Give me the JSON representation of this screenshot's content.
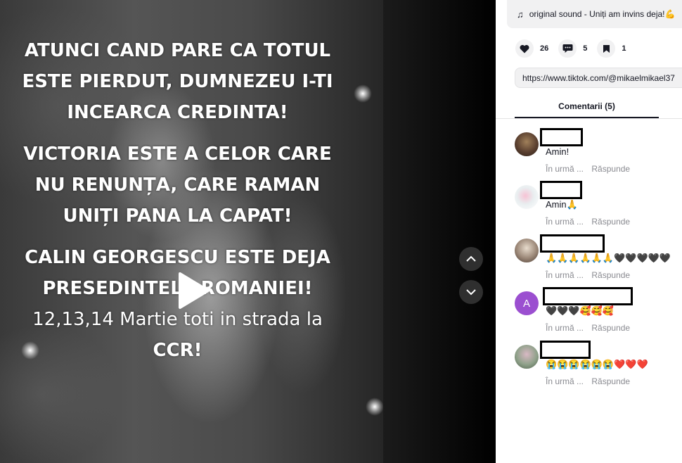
{
  "video": {
    "overlay_lines_1": [
      "ATUNCI CAND PARE CA TOTUL",
      "ESTE PIERDUT, DUMNEZEU I-TI",
      "INCEARCA CREDINTA!"
    ],
    "overlay_lines_2": [
      "VICTORIA ESTE A CELOR CARE",
      "NU RENUNȚA, CARE RAMAN",
      "UNIȚI PANA LA CAPAT!"
    ],
    "overlay_lines_3": [
      "CALIN GEORGESCU ESTE DEJA",
      "PRESEDINTELE ROMANIEI!",
      "12,13,14 Martie toti in strada la",
      "CCR!"
    ],
    "play_icon": "play-icon"
  },
  "nav": {
    "up_icon": "chevron-up-icon",
    "down_icon": "chevron-down-icon"
  },
  "sound": {
    "icon": "music-note-icon",
    "label": "original sound - Uniți am invins deja!💪"
  },
  "stats": {
    "likes": "26",
    "comments": "5",
    "saves": "1"
  },
  "share_url": "https://www.tiktok.com/@mikaelmikael37",
  "tabs": {
    "comments": "Comentarii (5)"
  },
  "comments": [
    {
      "text": "Amin!",
      "time": "În urmă ...",
      "reply": "Răspunde"
    },
    {
      "text": "Amin🙏",
      "time": "În urmă ...",
      "reply": "Răspunde"
    },
    {
      "text": "🙏🙏🙏🙏🙏🙏🖤🖤🖤🖤🖤",
      "time": "În urmă ...",
      "reply": "Răspunde"
    },
    {
      "text": "🖤🖤🖤🥰🥰🥰",
      "time": "În urmă ...",
      "reply": "Răspunde",
      "avatar_letter": "A"
    },
    {
      "text": "😭😭😭😭😭😭❤️❤️❤️",
      "time": "În urmă ...",
      "reply": "Răspunde"
    }
  ],
  "colors": {
    "accent_avatar": "#9b4fd0",
    "sidebar_bg": "#ffffff",
    "text": "#161823",
    "meta": "#8a8b91"
  }
}
